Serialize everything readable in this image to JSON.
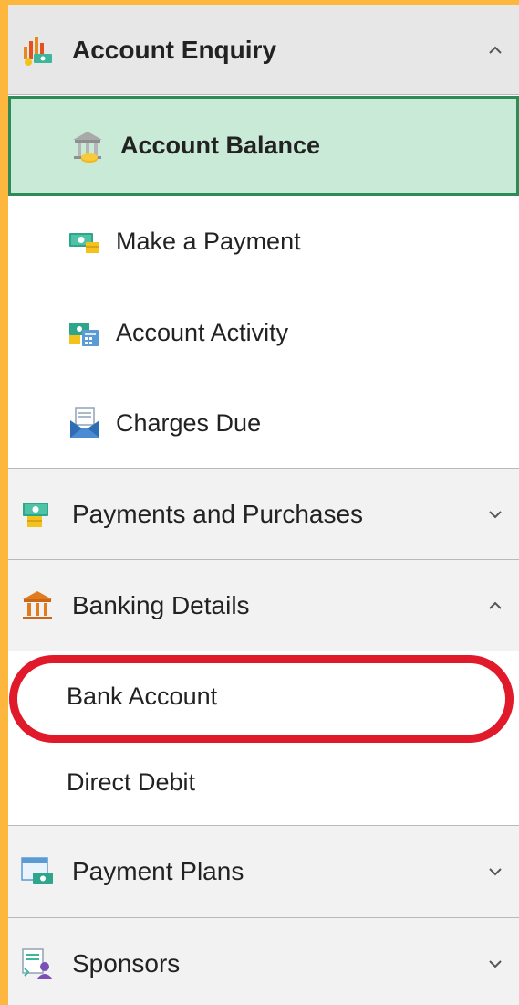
{
  "menu": {
    "account_enquiry": {
      "label": "Account Enquiry",
      "icon": "chart-coins-icon",
      "expanded": true,
      "items": [
        {
          "label": "Account Balance",
          "icon": "bank-coins-icon",
          "active": true
        },
        {
          "label": "Make a Payment",
          "icon": "cash-icon"
        },
        {
          "label": "Account Activity",
          "icon": "cash-calculator-icon"
        },
        {
          "label": "Charges Due",
          "icon": "envelope-icon"
        }
      ]
    },
    "payments_and_purchases": {
      "label": "Payments and Purchases",
      "icon": "cash-coins-icon",
      "expanded": false
    },
    "banking_details": {
      "label": "Banking Details",
      "icon": "bank-building-icon",
      "expanded": true,
      "items": [
        {
          "label": "Bank Account",
          "highlighted": true
        },
        {
          "label": "Direct Debit"
        }
      ]
    },
    "payment_plans": {
      "label": "Payment Plans",
      "icon": "calendar-cash-icon",
      "expanded": false
    },
    "sponsors": {
      "label": "Sponsors",
      "icon": "document-person-icon",
      "expanded": false
    }
  },
  "colors": {
    "background_border": "#FDB73E",
    "active_item_bg": "#C8EAD6",
    "active_item_border": "#2E8B57",
    "highlight_ring": "#E01A2A",
    "section_bg": "#F2F2F2"
  }
}
